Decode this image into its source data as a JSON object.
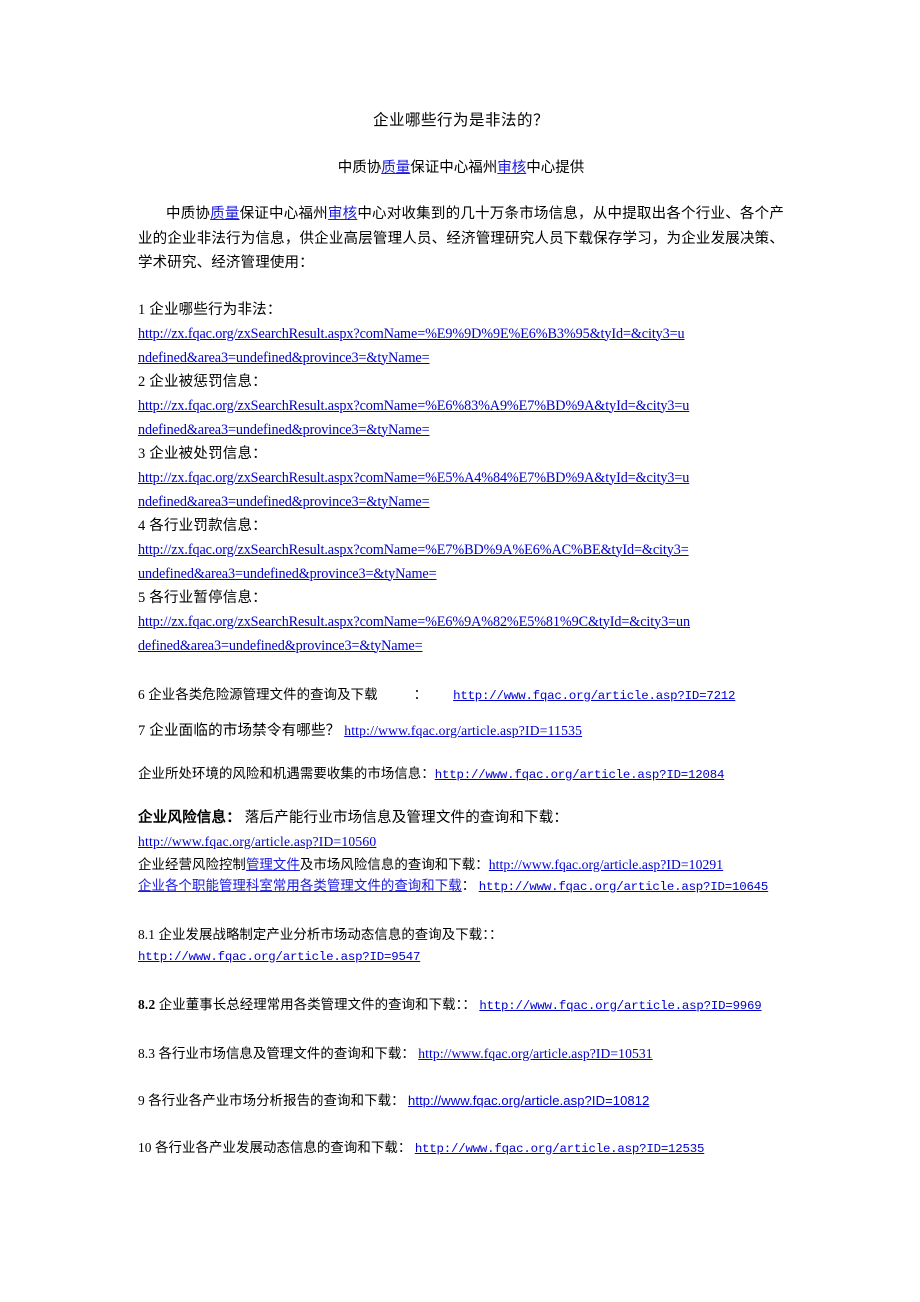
{
  "document": {
    "title": "企业哪些行为是非法的？",
    "subtitle": {
      "pre": "中质协",
      "link1": "质量",
      "mid": "保证中心福州",
      "link2": "审核",
      "post": "中心提供"
    },
    "intro": {
      "pre": "中质协",
      "link1": "质量",
      "mid": "保证中心福州",
      "link2": "审核",
      "post": "中心对收集到的几十万条市场信息，从中提取出各个行业、各个产业的企业非法行为信息，供企业高层管理人员、经济管理研究人员下载保存学习，为企业发展决策、学术研究、经济管理使用："
    }
  },
  "search_items": [
    {
      "label": "1  企业哪些行为非法：",
      "url_line1": "http://zx.fqac.org/zxSearchResult.aspx?comName=%E9%9D%9E%E6%B3%95&tyId=&city3=u",
      "url_line2": "ndefined&area3=undefined&province3=&tyName="
    },
    {
      "label": "2  企业被惩罚信息：",
      "url_line1": "http://zx.fqac.org/zxSearchResult.aspx?comName=%E6%83%A9%E7%BD%9A&tyId=&city3=u",
      "url_line2": "ndefined&area3=undefined&province3=&tyName="
    },
    {
      "label": "3  企业被处罚信息：",
      "url_line1": "http://zx.fqac.org/zxSearchResult.aspx?comName=%E5%A4%84%E7%BD%9A&tyId=&city3=u",
      "url_line2": "ndefined&area3=undefined&province3=&tyName="
    },
    {
      "label": "4  各行业罚款信息：",
      "url_line1": "http://zx.fqac.org/zxSearchResult.aspx?comName=%E7%BD%9A%E6%AC%BE&tyId=&city3=",
      "url_line2": "undefined&area3=undefined&province3=&tyName="
    },
    {
      "label": "5  各行业暂停信息：",
      "url_line1": "http://zx.fqac.org/zxSearchResult.aspx?comName=%E6%9A%82%E5%81%9C&tyId=&city3=un",
      "url_line2": "defined&area3=undefined&province3=&tyName="
    }
  ],
  "item6": {
    "label": "6  企业各类危险源管理文件的查询及下载",
    "colon": "：",
    "url": "http://www.fqac.org/article.asp?ID=7212"
  },
  "item7": {
    "label": "7  企业面临的市场禁令有哪些？",
    "url": "http://www.fqac.org/article.asp?ID=11535"
  },
  "market_info": {
    "label": "企业所处环境的风险和机遇需要收集的市场信息：",
    "url": "http://www.fqac.org/article.asp?ID=12084"
  },
  "risk_block": {
    "heading_bold": "企业风险信息：",
    "heading_rest": "落后产能行业市场信息及管理文件的查询和下载：",
    "heading_url": "http://www.fqac.org/article.asp?ID=10560",
    "line2_pre": "企业经营风险控制",
    "line2_link": "管理文件",
    "line2_post": "及市场风险信息的查询和下载：",
    "line2_url": "http://www.fqac.org/article.asp?ID=10291",
    "line3_label": "企业各个职能管理科室常用各类管理文件的查询和下载",
    "line3_colon": "：",
    "line3_url": "http://www.fqac.org/article.asp?ID=10645"
  },
  "item81": {
    "label": "8.1  企业发展战略制定产业分析市场动态信息的查询及下载：：",
    "url": "http://www.fqac.org/article.asp?ID=9547"
  },
  "item82": {
    "number": "8.2",
    "label": "企业董事长总经理常用各类管理文件的查询和下载：：",
    "url": "http://www.fqac.org/article.asp?ID=9969"
  },
  "item83": {
    "label": "8.3  各行业市场信息及管理文件的查询和下载：",
    "url": "http://www.fqac.org/article.asp?ID=10531"
  },
  "item9": {
    "label": "9  各行业各产业市场分析报告的查询和下载：",
    "url": "http://www.fqac.org/article.asp?ID=10812"
  },
  "item10": {
    "label": "10  各行业各产业发展动态信息的查询和下载：",
    "url": "http://www.fqac.org/article.asp?ID=12535"
  },
  "colors": {
    "link": "#0000d0",
    "text": "#000000",
    "background": "#ffffff"
  }
}
